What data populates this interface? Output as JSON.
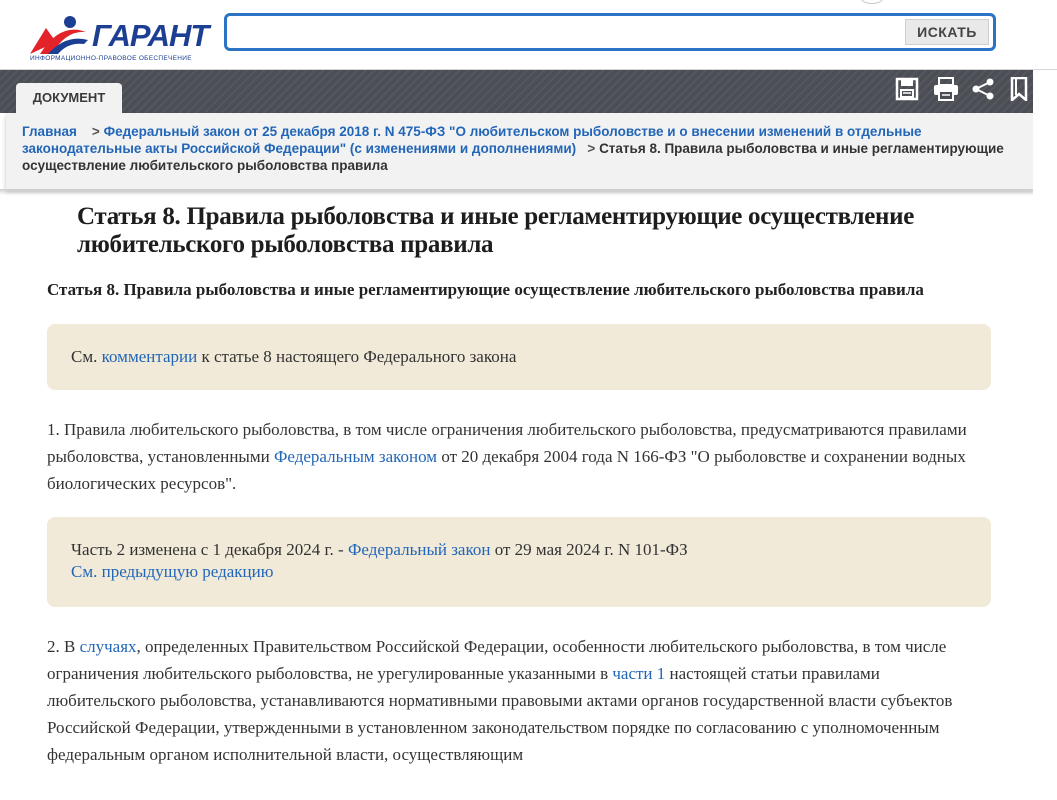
{
  "header": {
    "logo_text": "ГАРАНТ",
    "logo_subtitle": "ИНФОРМАЦИОННО-ПРАВОВОЕ ОБЕСПЕЧЕНИЕ",
    "search": {
      "value": "",
      "placeholder": ""
    },
    "search_button": "ИСКАТЬ"
  },
  "toolbar": {
    "tab_label": "ДОКУМЕНТ",
    "icons": [
      "save-icon",
      "print-icon",
      "share-icon",
      "bookmark-icon"
    ]
  },
  "breadcrumb": {
    "home": "Главная",
    "law_link": "Федеральный закон от 25 декабря 2018 г. N 475-ФЗ \"О любительском рыболовстве и о внесении изменений в отдельные законодательные акты Российской Федерации\" (с изменениями и дополнениями)",
    "current": "Статья 8. Правила рыболовства и иные регламентирующие осуществление любительского рыболовства правила",
    "separator": ">"
  },
  "article": {
    "title": "Статья 8. Правила рыболовства и иные регламентирующие осуществление любительского рыболовства правила",
    "subtitle": "Статья 8. Правила рыболовства и иные регламентирующие осуществление любительского рыболовства правила",
    "note1": {
      "prefix": "См. ",
      "link": "комментарии",
      "suffix": " к статье 8 настоящего Федерального закона"
    },
    "para1": {
      "before": "1. Правила любительского рыболовства, в том числе ограничения любительского рыболовства, предусматриваются правилами рыболовства, установленными ",
      "link": "Федеральным законом",
      "after": " от 20 декабря 2004 года N 166-ФЗ \"О рыболовстве и сохранении водных биологических ресурсов\"."
    },
    "note2": {
      "prefix": "Часть 2 изменена с 1 декабря 2024 г. - ",
      "link": "Федеральный закон",
      "suffix": " от 29 мая 2024 г. N 101-ФЗ",
      "prev_link": "См. предыдущую редакцию"
    },
    "para2": {
      "p1": "2. В ",
      "link1": "случаях",
      "p2": ", определенных Правительством Российской Федерации, особенности любительского рыболовства, в том числе ограничения любительского рыболовства, не урегулированные указанными в ",
      "link2": "части 1",
      "p3": " настоящей статьи правилами любительского рыболовства, устанавливаются нормативными правовыми актами органов государственной власти субъектов Российской Федерации, утвержденными в установленном законодательством порядке по согласованию с уполномоченным федеральным органом исполнительной власти, осуществляющим"
    }
  },
  "colors": {
    "accent_blue": "#2266b8",
    "note_bg": "#f1ead9",
    "band_dark": "#4b4f55"
  }
}
